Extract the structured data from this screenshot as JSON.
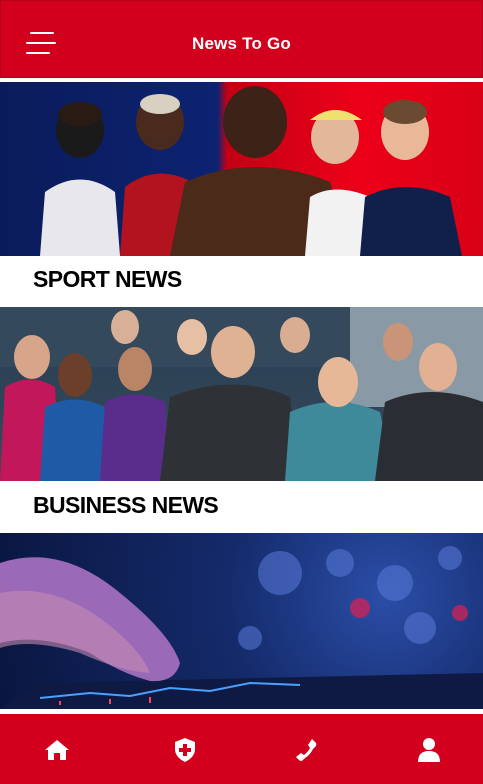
{
  "header": {
    "title": "News To Go",
    "menu_icon": "hamburger-menu-icon"
  },
  "sections": [
    {
      "label": "SPORT NEWS",
      "image": "sport-athletes-photo"
    },
    {
      "label": "BUSINESS NEWS",
      "image": "news-anchors-team-photo"
    },
    {
      "label": "",
      "image": "finger-touching-stock-chart-photo"
    }
  ],
  "tabbar": {
    "items": [
      "home-icon",
      "medical-shield-icon",
      "phone-icon",
      "user-icon"
    ]
  },
  "colors": {
    "brand_red": "#d2001c",
    "white": "#ffffff",
    "text": "#000000"
  }
}
